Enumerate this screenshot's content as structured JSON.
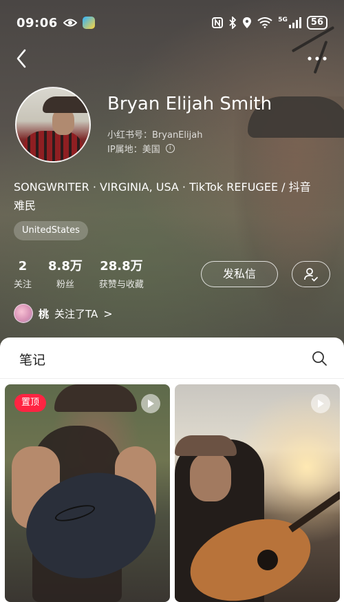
{
  "status_bar": {
    "time": "09:06",
    "battery": "56",
    "network": "5G"
  },
  "profile": {
    "name": "Bryan Elijah Smith",
    "xhs_id_label": "小红书号：",
    "xhs_id": "BryanElijah",
    "ip_label": "IP属地：",
    "ip_location": "美国",
    "bio_line1": "SONGWRITER · VIRGINIA, USA · TikTok REFUGEE / 抖音",
    "bio_line2": "难民",
    "tag": "UnitedStates"
  },
  "stats": [
    {
      "value": "2",
      "label": "关注"
    },
    {
      "value": "8.8万",
      "label": "粉丝"
    },
    {
      "value": "28.8万",
      "label": "获赞与收藏"
    }
  ],
  "actions": {
    "message_label": "发私信"
  },
  "mutual": {
    "name": "桃",
    "text": "关注了TA",
    "chevron": ">"
  },
  "notes": {
    "title": "笔记",
    "pinned_label": "置顶"
  },
  "icons": {
    "back": "chevron-left-icon",
    "more": "ellipsis-icon",
    "search": "search-icon",
    "play": "play-icon",
    "follow": "user-check-icon"
  },
  "colors": {
    "accent": "#ff2442"
  }
}
